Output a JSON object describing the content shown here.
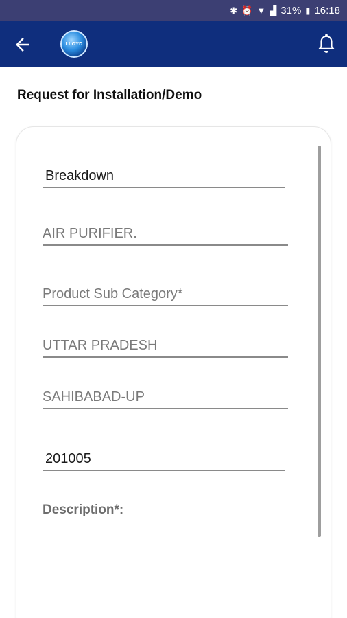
{
  "status_bar": {
    "icons": [
      "bluetooth-icon",
      "alarm-icon",
      "wifi-icon",
      "signal-icon"
    ],
    "battery": "31%",
    "time": "16:18"
  },
  "app_bar": {
    "logo_text": "LLOYD"
  },
  "page": {
    "title": "Request for Installation/Demo"
  },
  "form": {
    "service_type": "Breakdown",
    "product_category": "AIR PURIFIER.",
    "product_sub_category_placeholder": "Product Sub Category*",
    "state": "UTTAR PRADESH",
    "city": "SAHIBABAD-UP",
    "pincode": "201005",
    "description_label": "Description*:"
  }
}
